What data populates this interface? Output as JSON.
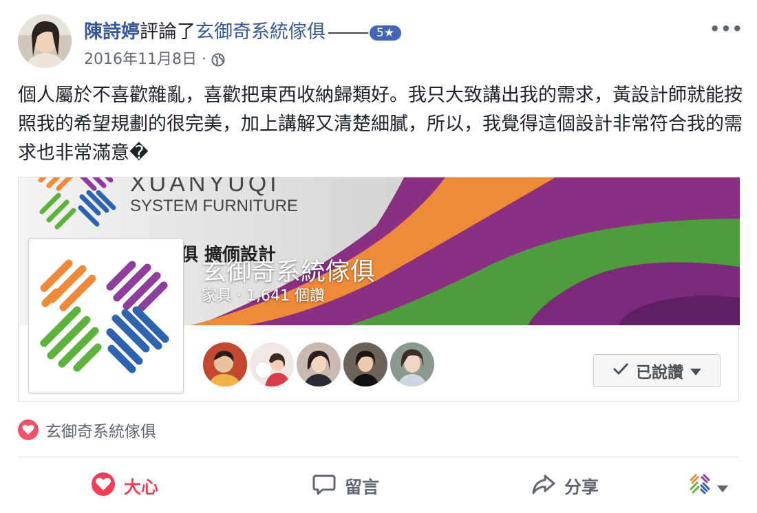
{
  "post": {
    "author": "陳詩婷",
    "verb": "評論了",
    "page": "玄御奇系統傢俱",
    "rating": "5★",
    "date": "2016年11月8日",
    "separator": "·",
    "more": "•••",
    "text": "個人屬於不喜歡雜亂，喜歡把東西收納歸類好。我只大致講出我的需求，黃設計師就能按照我的希望規劃的很完美，加上講解又清楚細膩，所以，我覺得這個設計非常符合我的需求也非常滿意�"
  },
  "card": {
    "brand_line1": "XUANYUQI",
    "brand_line2": "SYSTEM FURNITURE",
    "cover_partial": "俱 擴偭設計",
    "title": "玄御奇系統傢俱",
    "subtitle": "家具 · 1,641 個讚",
    "liked_label": "已說讚"
  },
  "reactions": {
    "label": "玄御奇系統傢俱"
  },
  "actions": {
    "love": "大心",
    "comment": "留言",
    "share": "分享"
  },
  "colors": {
    "link": "#365899",
    "love": "#f33e58",
    "orange": "#ef8a3b",
    "purple": "#8e3d9c",
    "green": "#5db33c",
    "blue": "#2e63b0"
  }
}
